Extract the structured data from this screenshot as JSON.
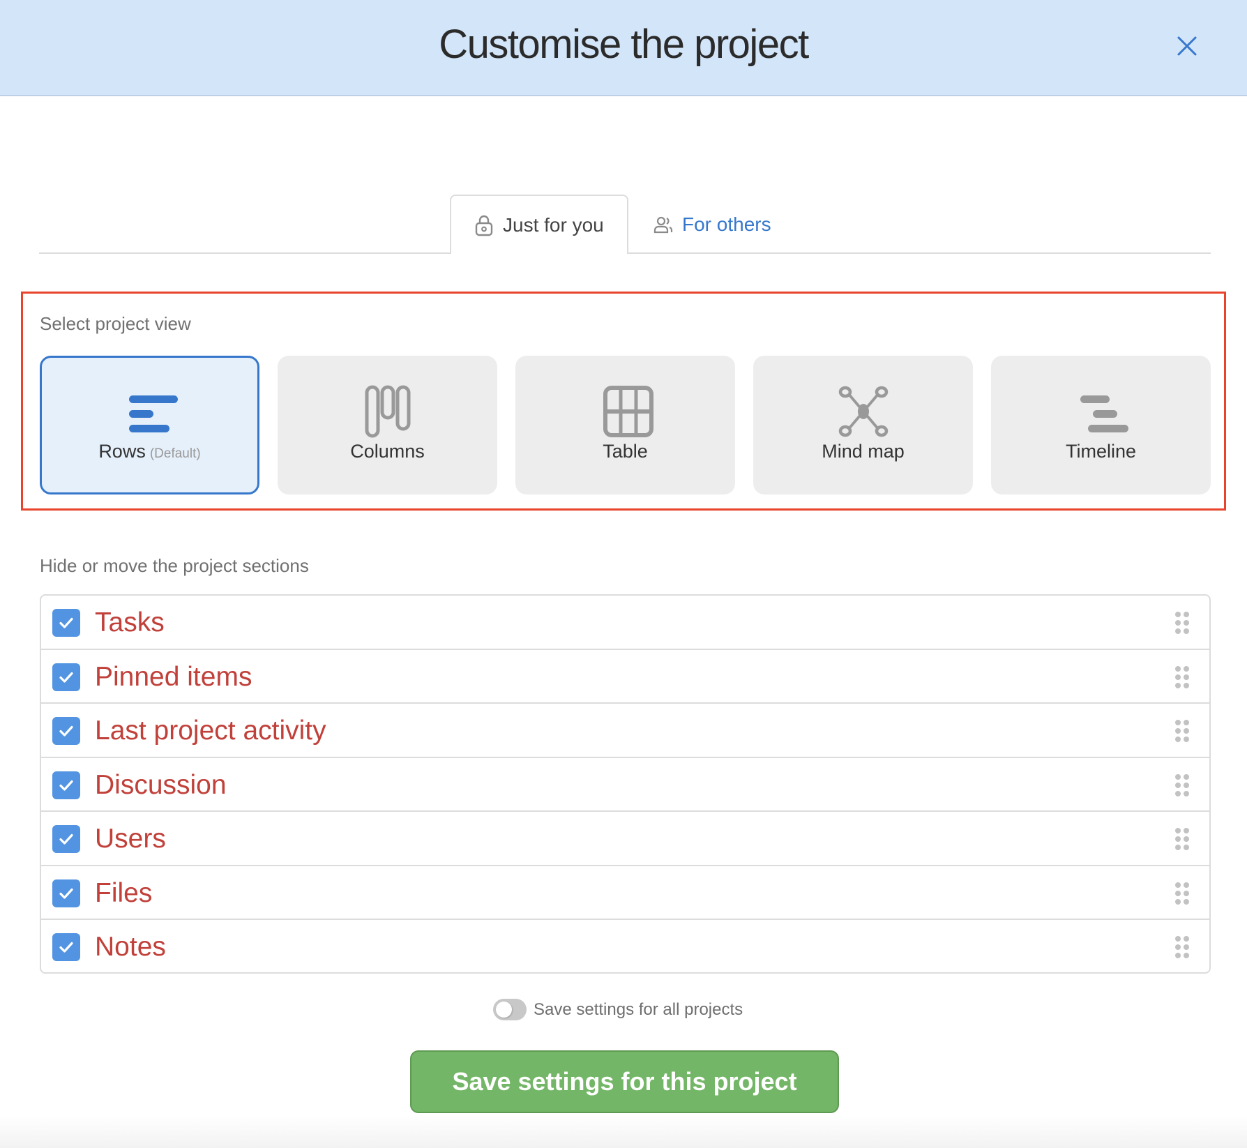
{
  "header": {
    "title": "Customise the project",
    "close_icon": "close-icon"
  },
  "tabs": [
    {
      "label": "Just for you",
      "icon": "lock-icon",
      "active": true
    },
    {
      "label": "For others",
      "icon": "users-icon",
      "active": false
    }
  ],
  "project_view": {
    "label": "Select project view",
    "options": [
      {
        "label": "Rows",
        "sublabel": "(Default)",
        "icon": "rows-icon",
        "selected": true
      },
      {
        "label": "Columns",
        "sublabel": "",
        "icon": "columns-icon",
        "selected": false
      },
      {
        "label": "Table",
        "sublabel": "",
        "icon": "table-icon",
        "selected": false
      },
      {
        "label": "Mind map",
        "sublabel": "",
        "icon": "mind-map-icon",
        "selected": false
      },
      {
        "label": "Timeline",
        "sublabel": "",
        "icon": "timeline-icon",
        "selected": false
      }
    ]
  },
  "sections": {
    "label": "Hide or move the project sections",
    "items": [
      {
        "label": "Tasks",
        "checked": true
      },
      {
        "label": "Pinned items",
        "checked": true
      },
      {
        "label": "Last project activity",
        "checked": true
      },
      {
        "label": "Discussion",
        "checked": true
      },
      {
        "label": "Users",
        "checked": true
      },
      {
        "label": "Files",
        "checked": true
      },
      {
        "label": "Notes",
        "checked": true
      }
    ]
  },
  "footer": {
    "toggle_label": "Save settings for all projects",
    "toggle_on": false,
    "save_button": "Save settings for this project"
  },
  "colors": {
    "accent": "#3677cc",
    "header_bg": "#d3e5f9",
    "highlight_frame": "#e8432b",
    "section_text": "#c1403a",
    "checkbox": "#5294e2",
    "save_button": "#74b667"
  }
}
